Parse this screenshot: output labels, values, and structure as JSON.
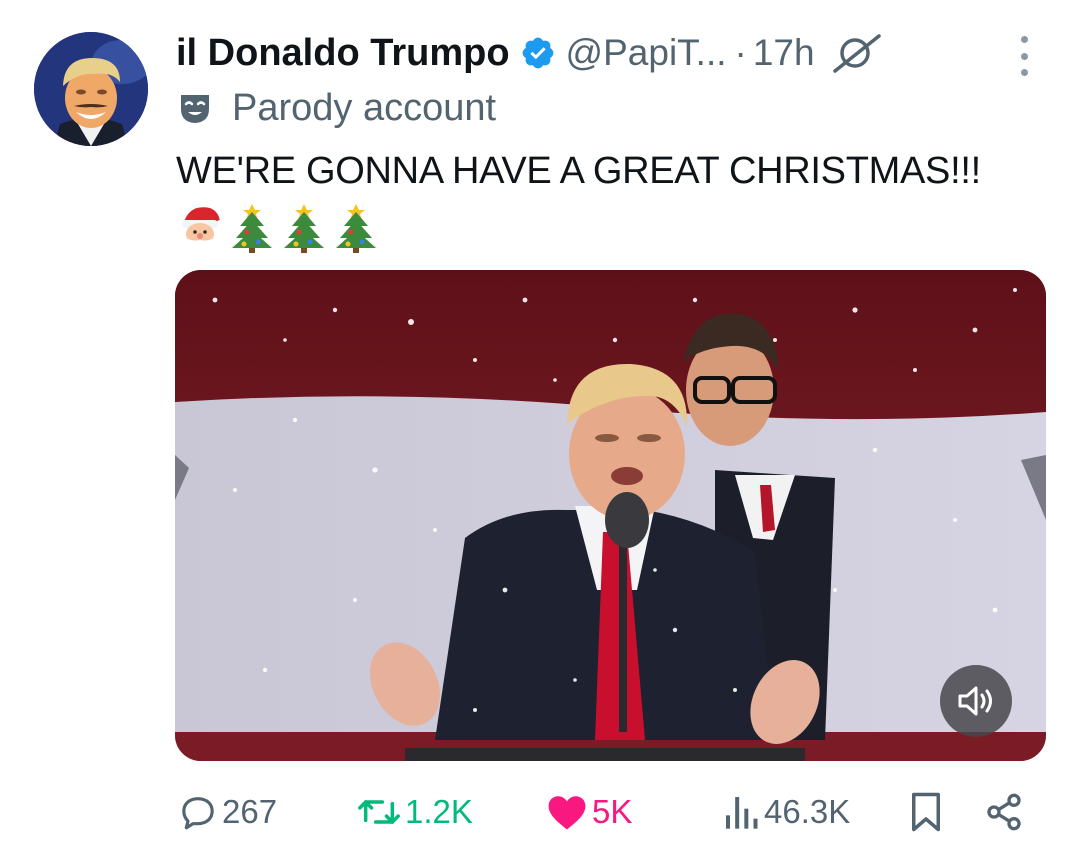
{
  "tweet": {
    "author": {
      "display_name": "il Donaldo Trumpo",
      "verified": true,
      "handle": "@PapiT...",
      "time_sep": "·",
      "time": "17h",
      "label": "Parody account"
    },
    "text": "WE'RE GONNA HAVE A GREAT CHRISTMAS!!!",
    "emojis": [
      "santa-face",
      "christmas-tree",
      "christmas-tree",
      "christmas-tree"
    ],
    "media": {
      "type": "video",
      "muted": true
    },
    "stats": {
      "replies": "267",
      "reposts": "1.2K",
      "likes": "5K",
      "views": "46.3K"
    }
  },
  "colors": {
    "text_primary": "#0f1419",
    "text_secondary": "#536471",
    "verified_blue": "#1d9bf0",
    "repost_green": "#00ba7c",
    "like_pink": "#f91880"
  },
  "icons": {
    "verified": "verified-badge-icon",
    "grok": "grok-icon",
    "more": "more-dots-icon",
    "parody": "theater-mask-icon",
    "reply": "speech-bubble-icon",
    "repost": "repost-arrows-icon",
    "like": "heart-icon",
    "views": "bar-chart-icon",
    "bookmark": "bookmark-icon",
    "share": "share-icon",
    "mute": "speaker-muted-icon"
  }
}
